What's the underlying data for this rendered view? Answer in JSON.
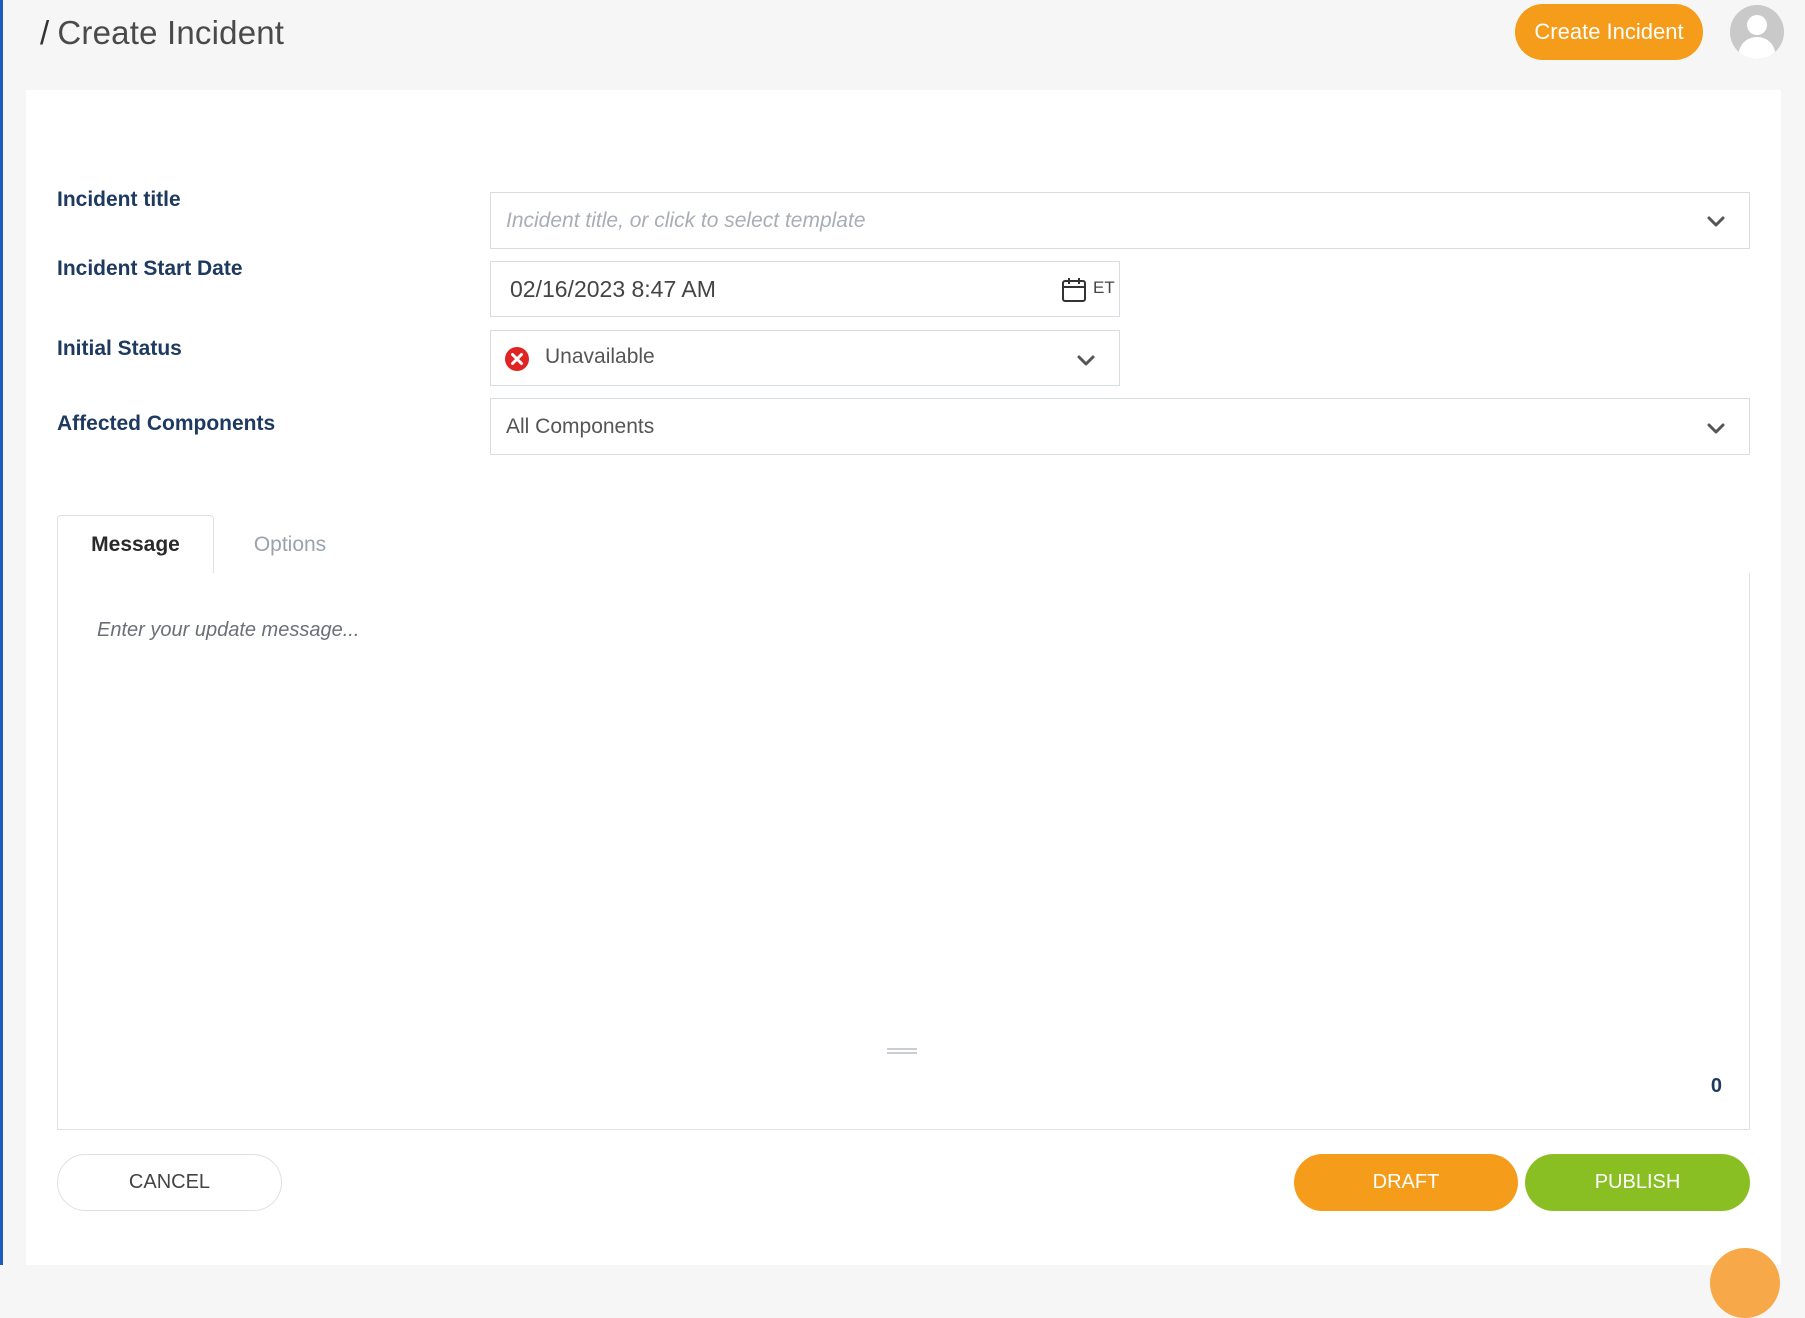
{
  "header": {
    "breadcrumb_separator": "/",
    "title": "Create Incident",
    "create_button_label": "Create Incident",
    "avatar_icon": "user-avatar-icon"
  },
  "form": {
    "incident_title": {
      "label": "Incident title",
      "placeholder": "Incident title, or click to select template",
      "value": ""
    },
    "start_date": {
      "label": "Incident Start Date",
      "value": "02/16/2023 8:47 AM",
      "timezone": "ET",
      "icon": "calendar-icon"
    },
    "initial_status": {
      "label": "Initial Status",
      "value": "Unavailable",
      "status_icon": "error-x-icon",
      "status_color": "#e02424"
    },
    "affected_components": {
      "label": "Affected Components",
      "value": "All Components"
    }
  },
  "tabs": [
    {
      "label": "Message",
      "active": true
    },
    {
      "label": "Options",
      "active": false
    }
  ],
  "editor": {
    "placeholder": "Enter your update message...",
    "char_count": "0"
  },
  "actions": {
    "cancel_label": "CANCEL",
    "draft_label": "DRAFT",
    "publish_label": "PUBLISH"
  },
  "colors": {
    "accent_orange": "#f59c1a",
    "publish_green": "#8abf24",
    "label_navy": "#1f3a60",
    "left_stripe_blue": "#1d5bbf"
  }
}
